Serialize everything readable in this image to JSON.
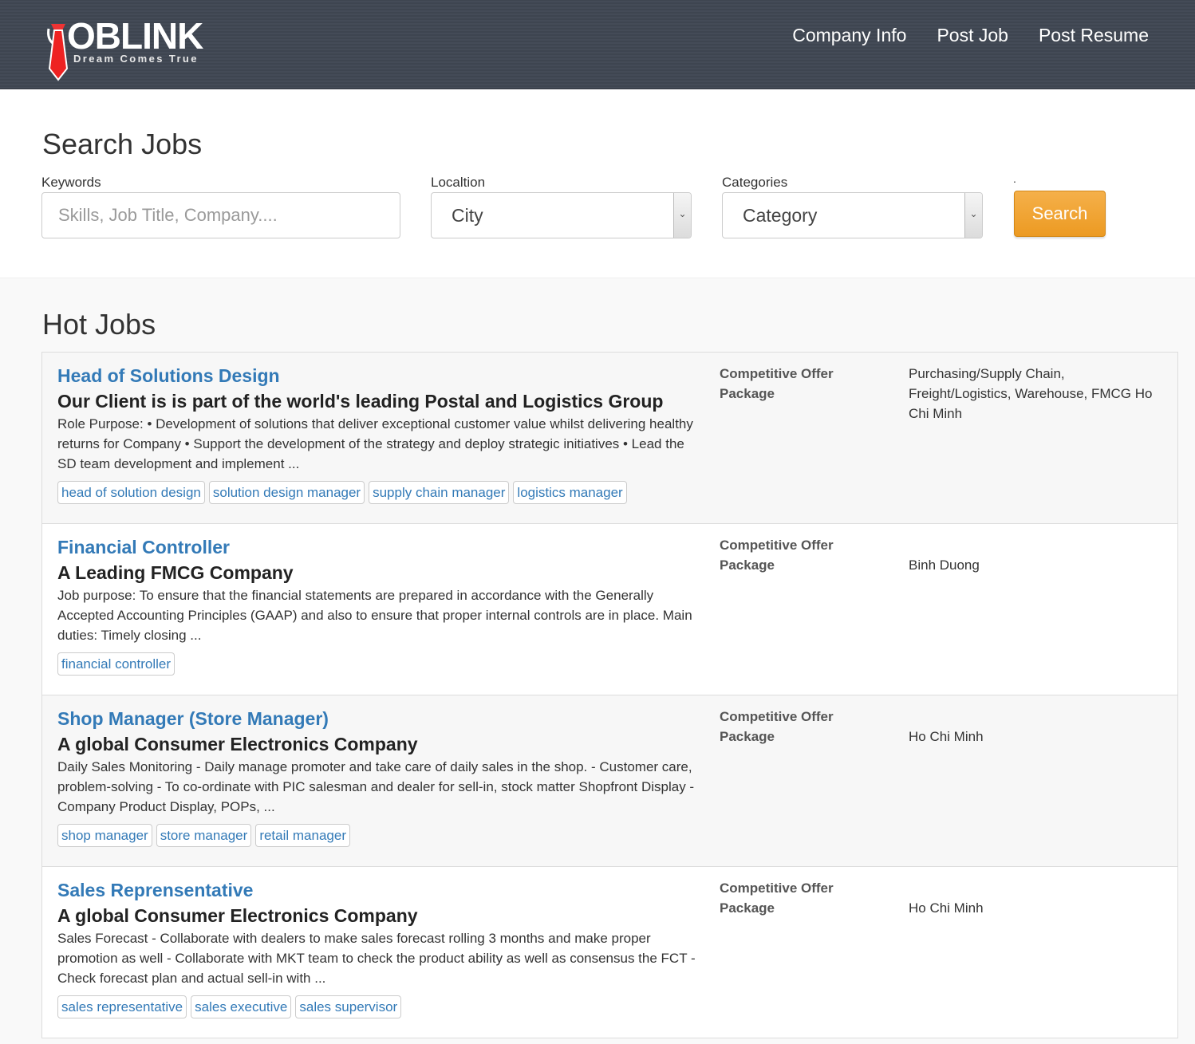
{
  "header": {
    "logo_text": "OBLINK",
    "logo_tagline": "Dream Comes True",
    "nav": [
      "Company Info",
      "Post Job",
      "Post Resume"
    ]
  },
  "search": {
    "title": "Search Jobs",
    "keywords_label": "Keywords",
    "keywords_placeholder": "Skills, Job Title, Company....",
    "location_label": "Localtion",
    "location_value": "City",
    "categories_label": "Categories",
    "categories_value": "Category",
    "dot_label": ".",
    "button_label": "Search"
  },
  "hot_jobs": {
    "title": "Hot Jobs",
    "jobs": [
      {
        "title": "Head of Solutions Design",
        "company": "Our Client is is part of the world's leading Postal and Logistics Group",
        "description": "Role Purpose: • Development of solutions that deliver exceptional customer value whilst delivering healthy returns for Company • Support the development of the strategy and deploy strategic initiatives • Lead the SD team development and implement ...",
        "tags": [
          "head of solution design",
          "solution design manager",
          "supply chain manager",
          "logistics manager"
        ],
        "salary": "Competitive Offer Package",
        "location": "Purchasing/Supply Chain, Freight/Logistics, Warehouse, FMCG Ho Chi Minh"
      },
      {
        "title": "Financial Controller",
        "company": "A Leading FMCG Company",
        "description": "Job purpose:   To ensure that the financial statements are prepared in accordance with the Generally Accepted Accounting Principles (GAAP) and also to ensure that proper internal controls are in place. Main duties:   Timely closing ...",
        "tags": [
          "financial controller"
        ],
        "salary": "Competitive Offer Package",
        "location": "Binh Duong"
      },
      {
        "title": "Shop Manager (Store Manager)",
        "company": "A global Consumer Electronics Company",
        "description": "Daily Sales Monitoring - Daily manage promoter and take care of daily sales in the shop. - Customer care, problem-solving - To co-ordinate with PIC salesman and dealer for sell-in, stock matter Shopfront Display - Company Product Display, POPs, ...",
        "tags": [
          "shop manager",
          "store manager",
          "retail manager"
        ],
        "salary": "Competitive Offer Package",
        "location": "Ho Chi Minh"
      },
      {
        "title": "Sales Reprensentative",
        "company": "A global Consumer Electronics Company",
        "description": "Sales Forecast - Collaborate with dealers to make sales forecast rolling 3 months and make proper promotion as well - Collaborate with MKT team to check the product ability as well as consensus the FCT - Check forecast plan and actual sell-in with ...",
        "tags": [
          "sales representative",
          "sales executive",
          "sales supervisor"
        ],
        "salary": "Competitive Offer Package",
        "location": "Ho Chi Minh"
      }
    ]
  }
}
